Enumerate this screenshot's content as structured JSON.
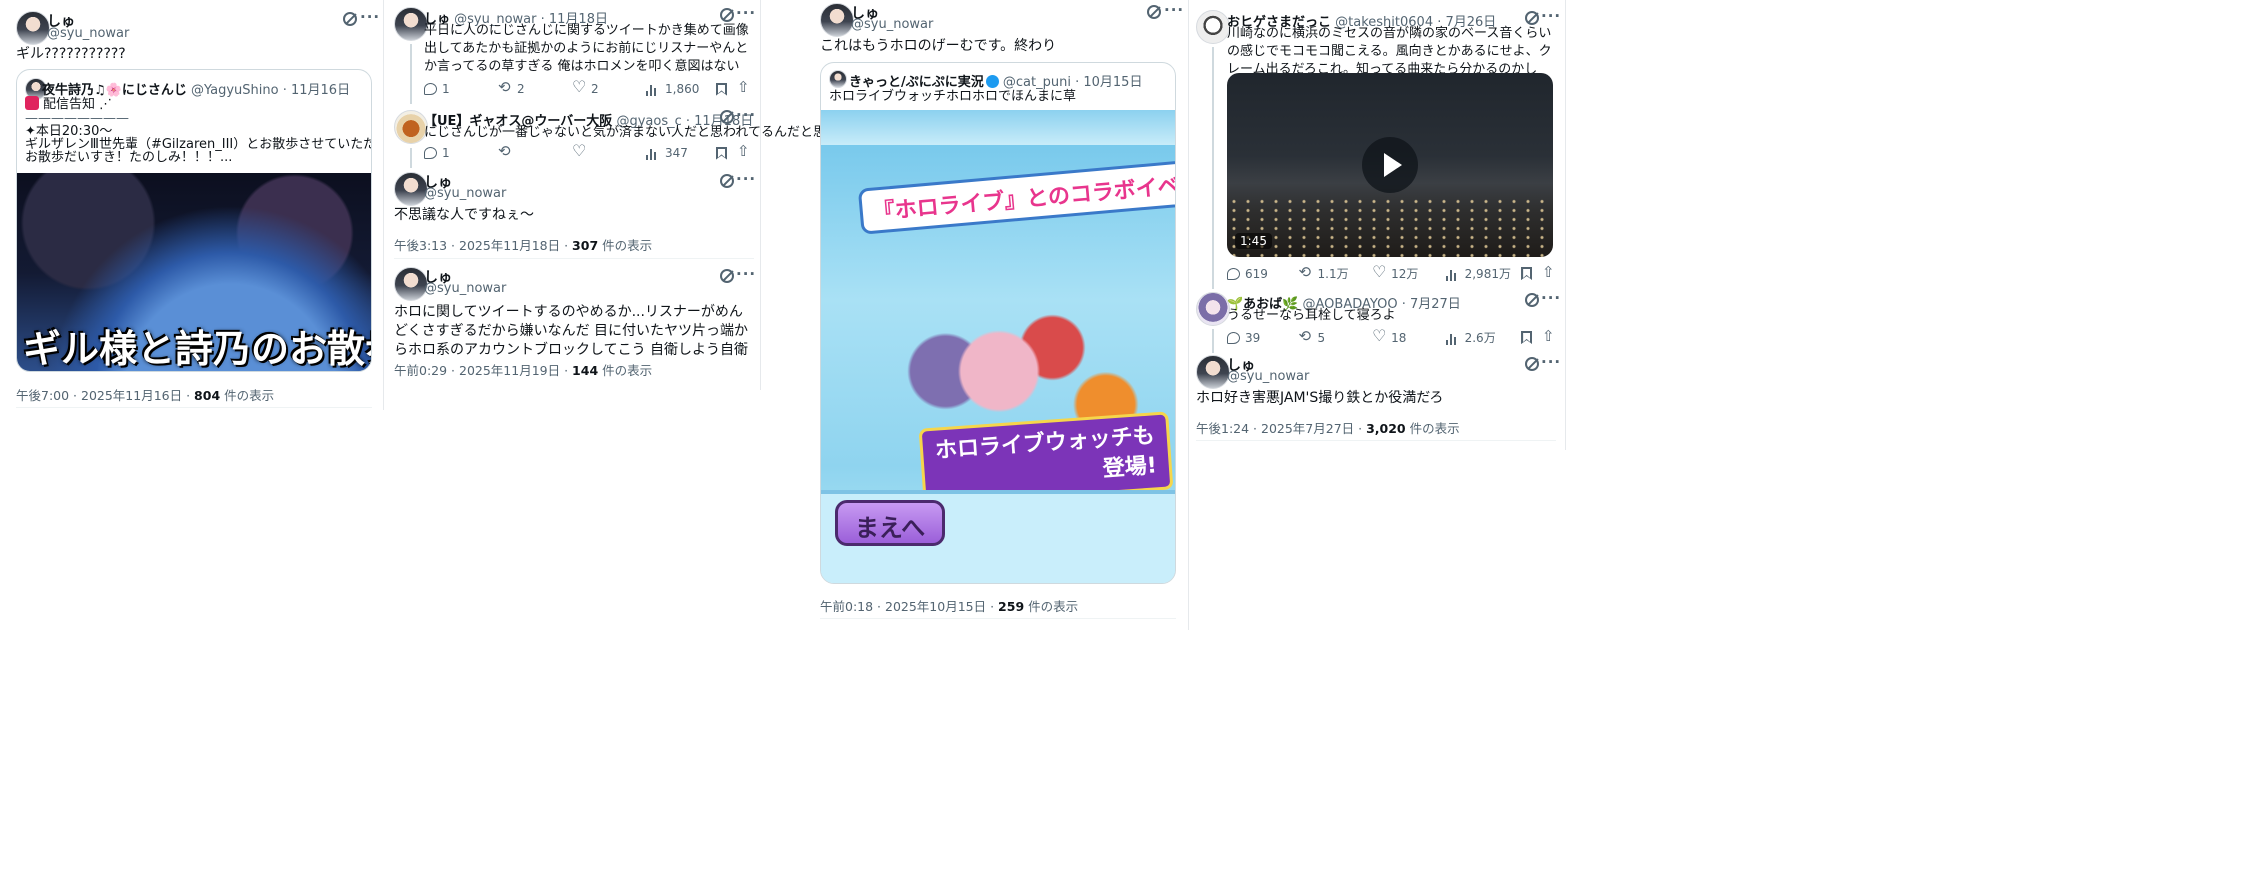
{
  "col1": {
    "author_name": "しゅ",
    "author_handle": "@syu_nowar",
    "text": "ギル???????????",
    "quote": {
      "name": "夜牛詩乃♫🌸にじさんじ",
      "handle": "@YagyuShino",
      "date": "· 11月16日",
      "line1": "配信告知 ⋰",
      "divider": "————————",
      "line2": "✦本日20:30〜",
      "line3": "ギルザレンⅢ世先輩（#Gilzaren_III）とお散歩させていただきます🚶",
      "line4": "お散歩だいすき！たのしみ！！！...",
      "image_caption": "ギル様と詩乃のお散歩"
    },
    "meta_time": "午後7:00 · 2025年11月16日 · ",
    "meta_views": "804",
    "meta_views_suffix": " 件の表示"
  },
  "col2": {
    "t1": {
      "name": "しゅ",
      "handle": "@syu_nowar · 11月18日",
      "text": "平日に人のにじさんじに関するツイートかき集めて画像出してあたかも証拠かのようにお前にじリスナーやんとか言ってるの草すぎる 俺はホロメンを叩く意図はないですよ。俺が嫌いなのはリスナーですよって話してるのになんで俺がにじリスナーだって話になるの??何論点変えてんだ会話下手くそか",
      "replies": "1",
      "retweets": "2",
      "likes": "2",
      "views": "1,860"
    },
    "t2": {
      "name": "【UE】ギャオス@ウーバー大阪",
      "handle": "@gyaos_c · 11月18日",
      "text": "にじさんじが一番じゃないと気が済まない人だと思われてるんだと思います",
      "replies": "1",
      "views": "347"
    },
    "t3": {
      "name": "しゅ",
      "handle": "@syu_nowar",
      "text": "不思議な人ですねぇ〜",
      "meta_time": "午後3:13 · 2025年11月18日 · ",
      "meta_views": "307",
      "meta_views_suffix": " 件の表示"
    },
    "t4": {
      "name": "しゅ",
      "handle": "@syu_nowar",
      "text": "ホロに関してツイートするのやめるか...リスナーがめんどくさすぎるだから嫌いなんだ 目に付いたヤツ片っ端からホロ系のアカウントブロックしてこう 自衛しよう自衛",
      "meta_time": "午前0:29 · 2025年11月19日 · ",
      "meta_views": "144",
      "meta_views_suffix": " 件の表示"
    }
  },
  "col3": {
    "author_name": "しゅ",
    "author_handle": "@syu_nowar",
    "text": "これはもうホロのげーむです。終わり",
    "quote": {
      "name": "きゃっと/ぷにぷに実況",
      "handle": "@cat_puni",
      "date": "· 10月15日",
      "text": "ホロライブウォッチホロホロでほんまに草",
      "banner": "『ホロライブ』とのコラボイベント開催!",
      "badge_line1": "ホロライブウォッチも",
      "badge_line2": "登場!",
      "button": "まえへ"
    },
    "meta_time": "午前0:18 · 2025年10月15日 · ",
    "meta_views": "259",
    "meta_views_suffix": " 件の表示"
  },
  "col4": {
    "t1": {
      "name": "おヒゲさまだっこ",
      "handle": "@takeshit0604 · 7月26日",
      "text": "川崎なのに横浜のミセスの音が隣の家のベース音くらいの感じでモコモコ聞こえる。風向きとかあるにせよ、クレーム出るだろこれ。知ってる曲来たら分かるのかしら？",
      "duration": "1:45",
      "replies": "619",
      "retweets": "1.1万",
      "likes": "12万",
      "views": "2,981万"
    },
    "t2": {
      "name": "🌱あおば🌿",
      "handle": "@AOBADAYOO · 7月27日",
      "text": "うるせーなら耳栓して寝ろよ",
      "replies": "39",
      "retweets": "5",
      "likes": "18",
      "views": "2.6万"
    },
    "t3": {
      "name": "しゅ",
      "handle": "@syu_nowar",
      "text": "ホロ好き害悪JAM'S撮り鉄とか役満だろ",
      "meta_time": "午後1:24 · 2025年7月27日 · ",
      "meta_views": "3,020",
      "meta_views_suffix": " 件の表示"
    }
  }
}
